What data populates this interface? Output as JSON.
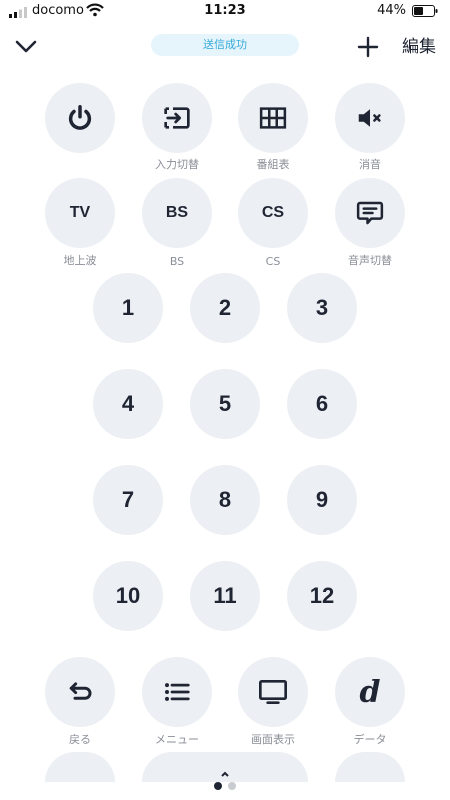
{
  "status_bar": {
    "carrier": "docomo",
    "time": "11:23",
    "battery": "44%"
  },
  "header": {
    "toast": "送信成功",
    "edit_label": "編集"
  },
  "row1": {
    "input_label": "入力切替",
    "guide_label": "番組表",
    "mute_label": "消音"
  },
  "row2": {
    "tv_text": "TV",
    "tv_label": "地上波",
    "bs_text": "BS",
    "bs_label": "BS",
    "cs_text": "CS",
    "cs_label": "CS",
    "audio_label": "音声切替"
  },
  "numbers": [
    "1",
    "2",
    "3",
    "4",
    "5",
    "6",
    "7",
    "8",
    "9",
    "10",
    "11",
    "12"
  ],
  "bottom": {
    "back_label": "戻る",
    "menu_label": "メニュー",
    "display_label": "画面表示",
    "data_label": "データ",
    "data_glyph": "d"
  },
  "colors": {
    "button_bg": "#eceff3",
    "toast_bg": "#e6f5fb",
    "toast_text": "#36a9d9",
    "dot_active": "#1f2533",
    "dot_inactive": "#c8cbd0"
  }
}
